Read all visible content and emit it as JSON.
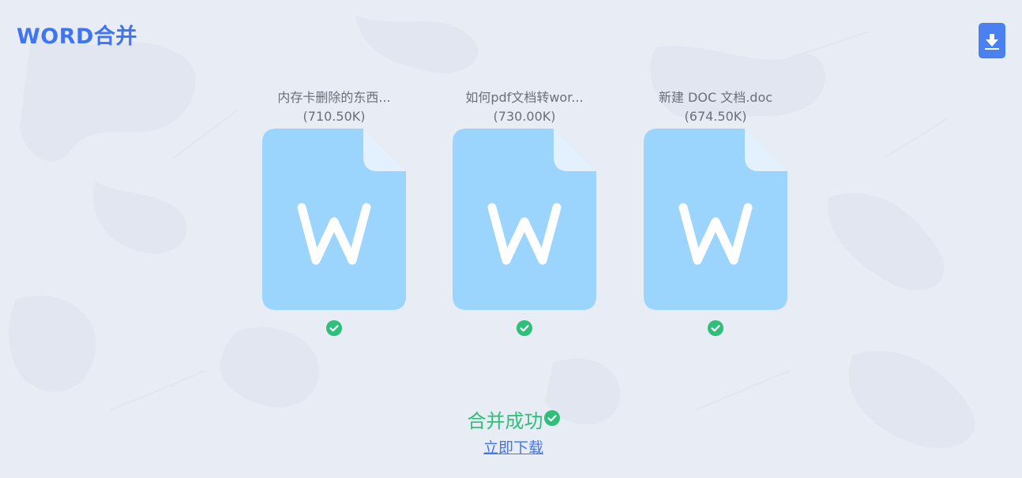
{
  "app": {
    "title": "WORD合并",
    "accent_color": "#3f74f2",
    "success_color": "#2fbf7a",
    "doc_icon_color": "#9bd4fd"
  },
  "toolbar": {
    "download_icon": "download-icon"
  },
  "files": [
    {
      "name": "内存卡删除的东西...",
      "size": "(710.50K)",
      "status_icon": "check-circle-icon"
    },
    {
      "name": "如何pdf文档转wor...",
      "size": "(730.00K)",
      "status_icon": "check-circle-icon"
    },
    {
      "name": "新建 DOC 文档.doc",
      "size": "(674.50K)",
      "status_icon": "check-circle-icon"
    }
  ],
  "result": {
    "status_text": "合并成功",
    "status_icon": "check-circle-icon",
    "download_label": "立即下载"
  }
}
